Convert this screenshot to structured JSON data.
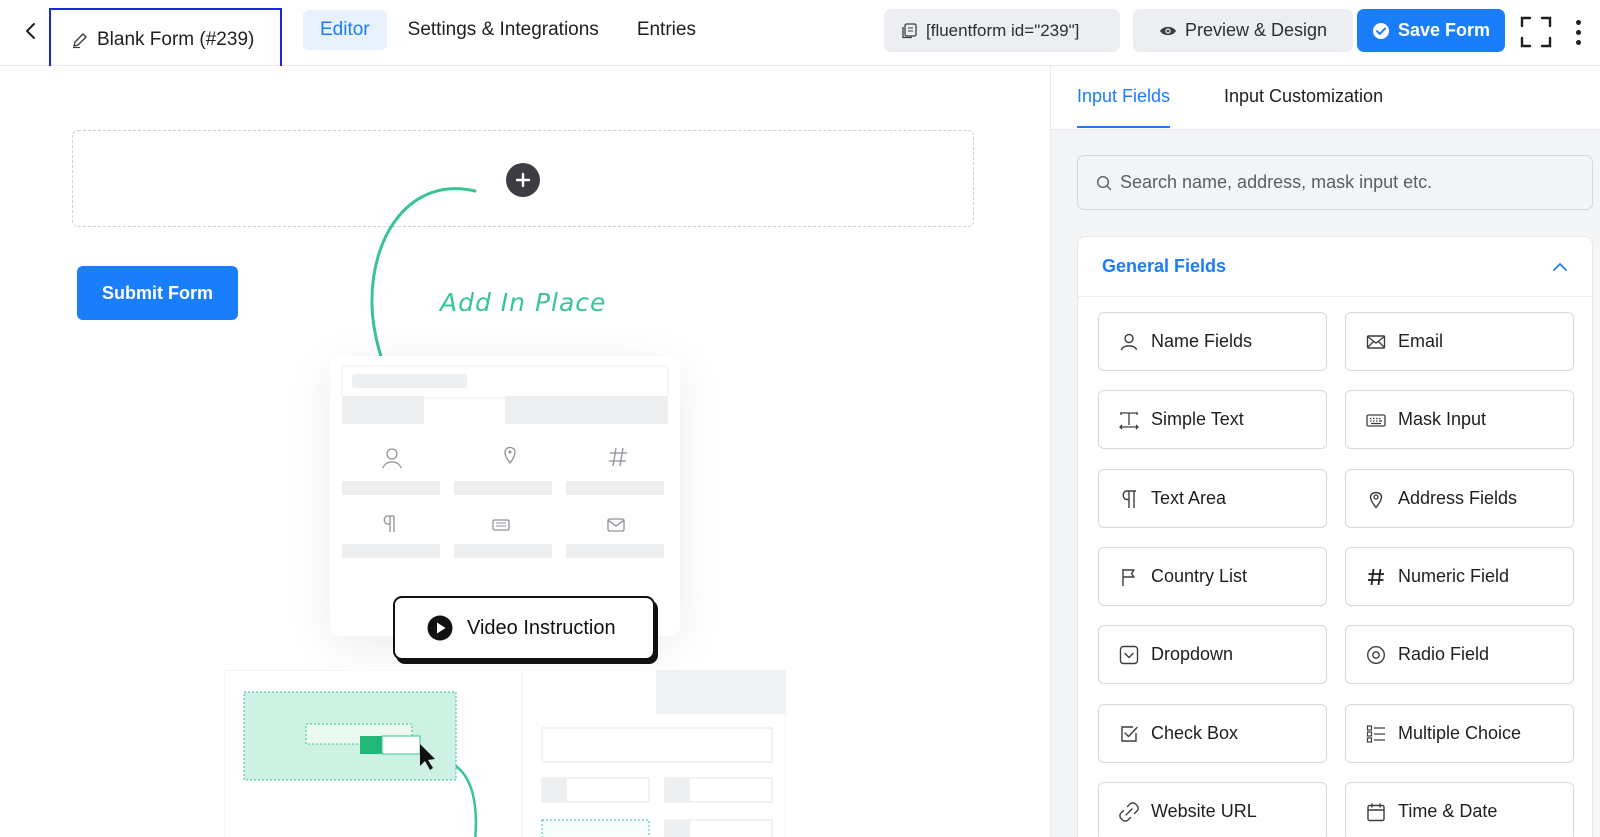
{
  "header": {
    "form_title": "Blank Form (#239)",
    "nav": [
      "Editor",
      "Settings & Integrations",
      "Entries"
    ],
    "active_nav": "Editor",
    "shortcode": "[fluentform id=\"239\"]",
    "preview_label": "Preview & Design",
    "save_label": "Save Form"
  },
  "canvas": {
    "submit_label": "Submit Form",
    "add_in_place": "Add In Place",
    "video_label": "Video Instruction"
  },
  "panel": {
    "tabs": [
      "Input Fields",
      "Input Customization"
    ],
    "search_placeholder": "Search name, address, mask input etc.",
    "section_title": "General Fields",
    "fields": [
      {
        "label": "Name Fields",
        "icon": "user-icon"
      },
      {
        "label": "Email",
        "icon": "envelope-icon"
      },
      {
        "label": "Simple Text",
        "icon": "text-cursor-icon"
      },
      {
        "label": "Mask Input",
        "icon": "keyboard-icon"
      },
      {
        "label": "Text Area",
        "icon": "paragraph-icon"
      },
      {
        "label": "Address Fields",
        "icon": "map-pin-icon"
      },
      {
        "label": "Country List",
        "icon": "flag-icon"
      },
      {
        "label": "Numeric Field",
        "icon": "hash-icon"
      },
      {
        "label": "Dropdown",
        "icon": "dropdown-icon"
      },
      {
        "label": "Radio Field",
        "icon": "radio-icon"
      },
      {
        "label": "Check Box",
        "icon": "checkbox-icon"
      },
      {
        "label": "Multiple Choice",
        "icon": "list-icon"
      },
      {
        "label": "Website URL",
        "icon": "link-icon"
      },
      {
        "label": "Time & Date",
        "icon": "calendar-icon"
      }
    ]
  },
  "colors": {
    "accent": "#1a7efb",
    "accent_light": "#e8f1fc",
    "highlight_border": "#1b2bd8",
    "illustration_green": "#36c593"
  }
}
